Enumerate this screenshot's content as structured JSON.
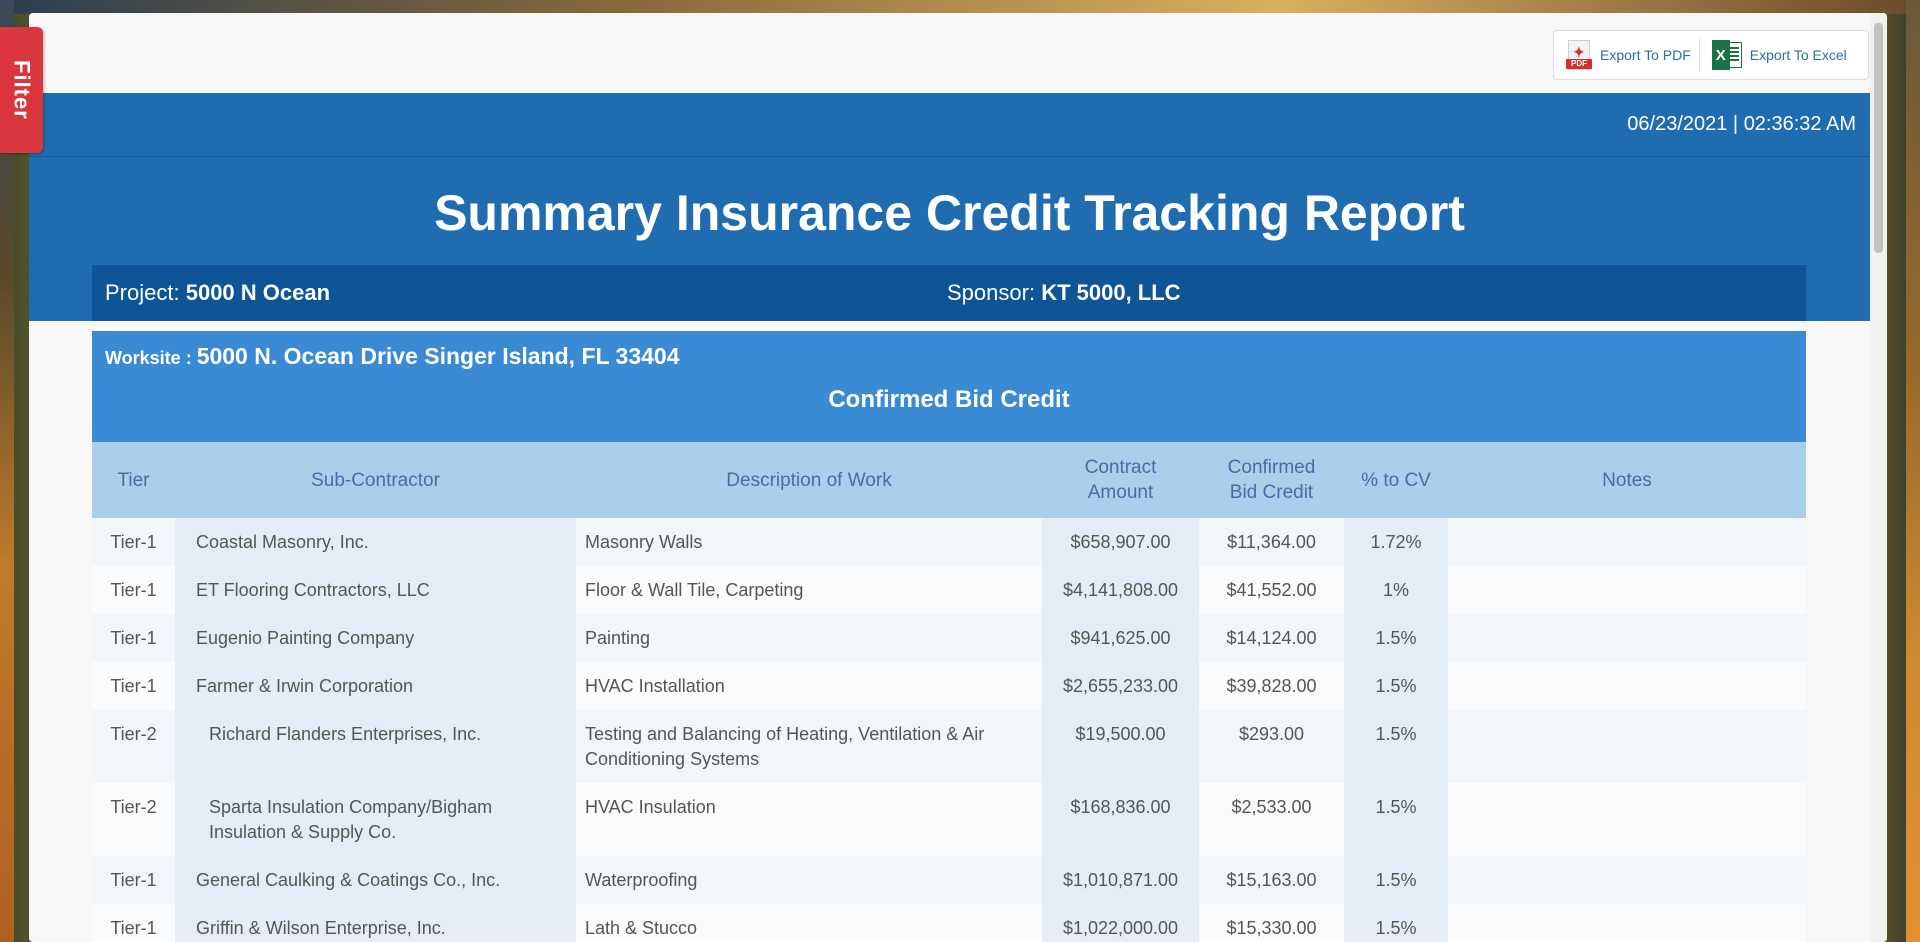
{
  "filter_tab": {
    "label": "Filter"
  },
  "export": {
    "pdf_label": "Export To PDF",
    "pdf_badge": "PDF",
    "excel_label": "Export To Excel"
  },
  "header": {
    "datetime": "06/23/2021 | 02:36:32 AM",
    "title": "Summary Insurance Credit Tracking Report",
    "project_label": "Project:",
    "project_value": "5000 N Ocean",
    "sponsor_label": "Sponsor:",
    "sponsor_value": "KT 5000, LLC"
  },
  "worksite": {
    "label": "Worksite :",
    "value": "5000 N. Ocean Drive Singer Island, FL 33404",
    "section_title": "Confirmed Bid Credit"
  },
  "table": {
    "columns": {
      "tier": "Tier",
      "sub": "Sub-Contractor",
      "desc": "Description of Work",
      "amount_1": "Contract",
      "amount_2": "Amount",
      "bid_1": "Confirmed",
      "bid_2": "Bid Credit",
      "pct": "% to CV",
      "notes": "Notes"
    },
    "rows": [
      {
        "tier": "Tier-1",
        "sub": "Coastal Masonry, Inc.",
        "desc": "Masonry Walls",
        "amount": "$658,907.00",
        "bid": "$11,364.00",
        "pct": "1.72%",
        "notes": ""
      },
      {
        "tier": "Tier-1",
        "sub": "ET Flooring Contractors, LLC",
        "desc": "Floor & Wall Tile, Carpeting",
        "amount": "$4,141,808.00",
        "bid": "$41,552.00",
        "pct": "1%",
        "notes": ""
      },
      {
        "tier": "Tier-1",
        "sub": "Eugenio Painting Company",
        "desc": "Painting",
        "amount": "$941,625.00",
        "bid": "$14,124.00",
        "pct": "1.5%",
        "notes": ""
      },
      {
        "tier": "Tier-1",
        "sub": "Farmer & Irwin Corporation",
        "desc": "HVAC Installation",
        "amount": "$2,655,233.00",
        "bid": "$39,828.00",
        "pct": "1.5%",
        "notes": ""
      },
      {
        "tier": "Tier-2",
        "sub": "Richard Flanders Enterprises, Inc.",
        "desc": "Testing and Balancing of Heating, Ventilation & Air Conditioning Systems",
        "amount": "$19,500.00",
        "bid": "$293.00",
        "pct": "1.5%",
        "notes": ""
      },
      {
        "tier": "Tier-2",
        "sub": "Sparta Insulation Company/Bigham Insulation & Supply Co.",
        "desc": "HVAC Insulation",
        "amount": "$168,836.00",
        "bid": "$2,533.00",
        "pct": "1.5%",
        "notes": ""
      },
      {
        "tier": "Tier-1",
        "sub": "General Caulking & Coatings Co., Inc.",
        "desc": "Waterproofing",
        "amount": "$1,010,871.00",
        "bid": "$15,163.00",
        "pct": "1.5%",
        "notes": ""
      },
      {
        "tier": "Tier-1",
        "sub": "Griffin & Wilson Enterprise, Inc.",
        "desc": "Lath & Stucco",
        "amount": "$1,022,000.00",
        "bid": "$15,330.00",
        "pct": "1.5%",
        "notes": ""
      }
    ]
  }
}
